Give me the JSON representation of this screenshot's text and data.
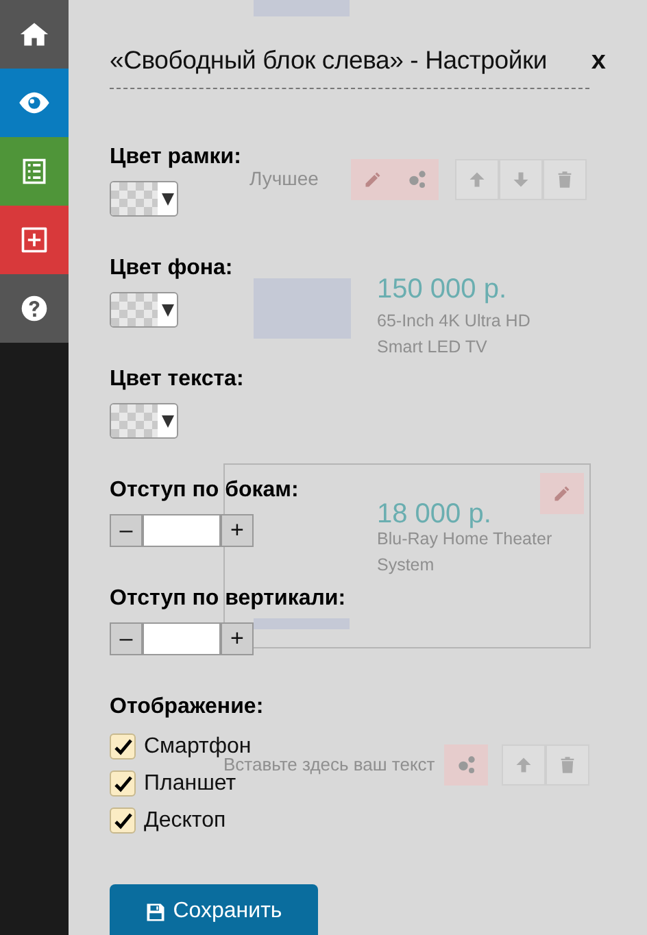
{
  "sidebar": {
    "items": [
      {
        "kind": "home",
        "color": "#555555"
      },
      {
        "kind": "eye",
        "color": "#0a7cbf"
      },
      {
        "kind": "list",
        "color": "#4f9539"
      },
      {
        "kind": "add",
        "color": "#d8393b"
      },
      {
        "kind": "help",
        "color": "#555555"
      }
    ]
  },
  "background": {
    "blocks": [
      {
        "kind": "label",
        "text": "Лучшее"
      },
      {
        "kind": "product",
        "price": "150 000 р.",
        "name": "65-Inch 4K Ultra HD Smart LED TV"
      },
      {
        "kind": "product",
        "price": "18 000 р.",
        "name": "Blu-Ray Home Theater System"
      },
      {
        "kind": "text",
        "text": "Вставьте здесь ваш текст"
      }
    ]
  },
  "settings": {
    "title": "«Свободный блок слева» - Настройки",
    "close": "x",
    "fields": [
      {
        "kind": "color",
        "label": "Цвет рамки:"
      },
      {
        "kind": "color",
        "label": "Цвет фона:"
      },
      {
        "kind": "color",
        "label": "Цвет текста:"
      },
      {
        "kind": "spinner",
        "label": "Отступ по бокам:",
        "minus": "–",
        "plus": "+"
      },
      {
        "kind": "spinner",
        "label": "Отступ по вертикали:",
        "minus": "–",
        "plus": "+"
      },
      {
        "kind": "checks",
        "label": "Отображение:",
        "options": [
          {
            "label": "Смартфон",
            "checked": true
          },
          {
            "label": "Планшет",
            "checked": true
          },
          {
            "label": "Десктоп",
            "checked": true
          }
        ]
      }
    ],
    "save": "Сохранить"
  }
}
